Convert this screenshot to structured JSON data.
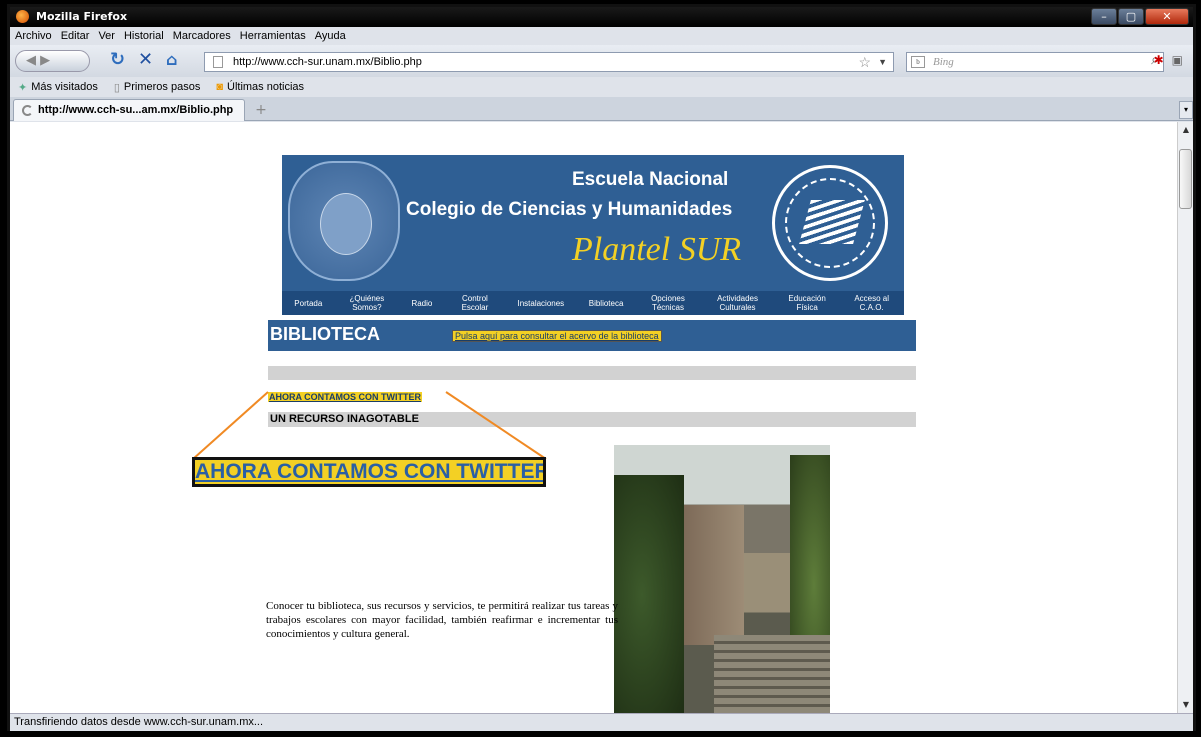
{
  "window": {
    "title": "Mozilla Firefox",
    "min": "–",
    "max": "▢",
    "close": "✕"
  },
  "menu": [
    "Archivo",
    "Editar",
    "Ver",
    "Historial",
    "Marcadores",
    "Herramientas",
    "Ayuda"
  ],
  "nav": {
    "url": "http://www.cch-sur.unam.mx/Biblio.php",
    "search_placeholder": "Bing",
    "search_engine": "bing-icon"
  },
  "bookmarks": [
    "Más visitados",
    "Primeros pasos",
    "Últimas noticias"
  ],
  "tab": {
    "title": "http://www.cch-su...am.mx/Biblio.php",
    "new": "+"
  },
  "status": "Transfiriendo datos desde www.cch-sur.unam.mx...",
  "banner": {
    "line1": "Escuela Nacional",
    "line2": "Colegio de Ciencias y Humanidades",
    "line3": "Plantel SUR",
    "nav": [
      "Portada",
      "¿Quiénes Somos?",
      "Radio",
      "Control Escolar",
      "Instalaciones",
      "Biblioteca",
      "Opciones Técnicas",
      "Actividades Culturales",
      "Educación Física",
      "Acceso al C.A.O."
    ]
  },
  "page": {
    "section_title": "BIBLIOTECA",
    "catalog_link": "Pulsa aquí para consultar el acervo de la biblioteca",
    "twitter_link": "AHORA CONTAMOS CON TWITTER",
    "subheading": "UN RECURSO INAGOTABLE",
    "zoom_text": "AHORA CONTAMOS CON TWITTER",
    "paragraph": "Conocer tu biblioteca, sus recursos y servicios, te permitirá realizar tus tareas y trabajos escolares con mayor facilidad, también reafirmar e incrementar tus conocimientos y cultura general."
  },
  "colors": {
    "banner": "#2f5f94",
    "highlight": "#f3d024",
    "callout": "#f08a24"
  }
}
